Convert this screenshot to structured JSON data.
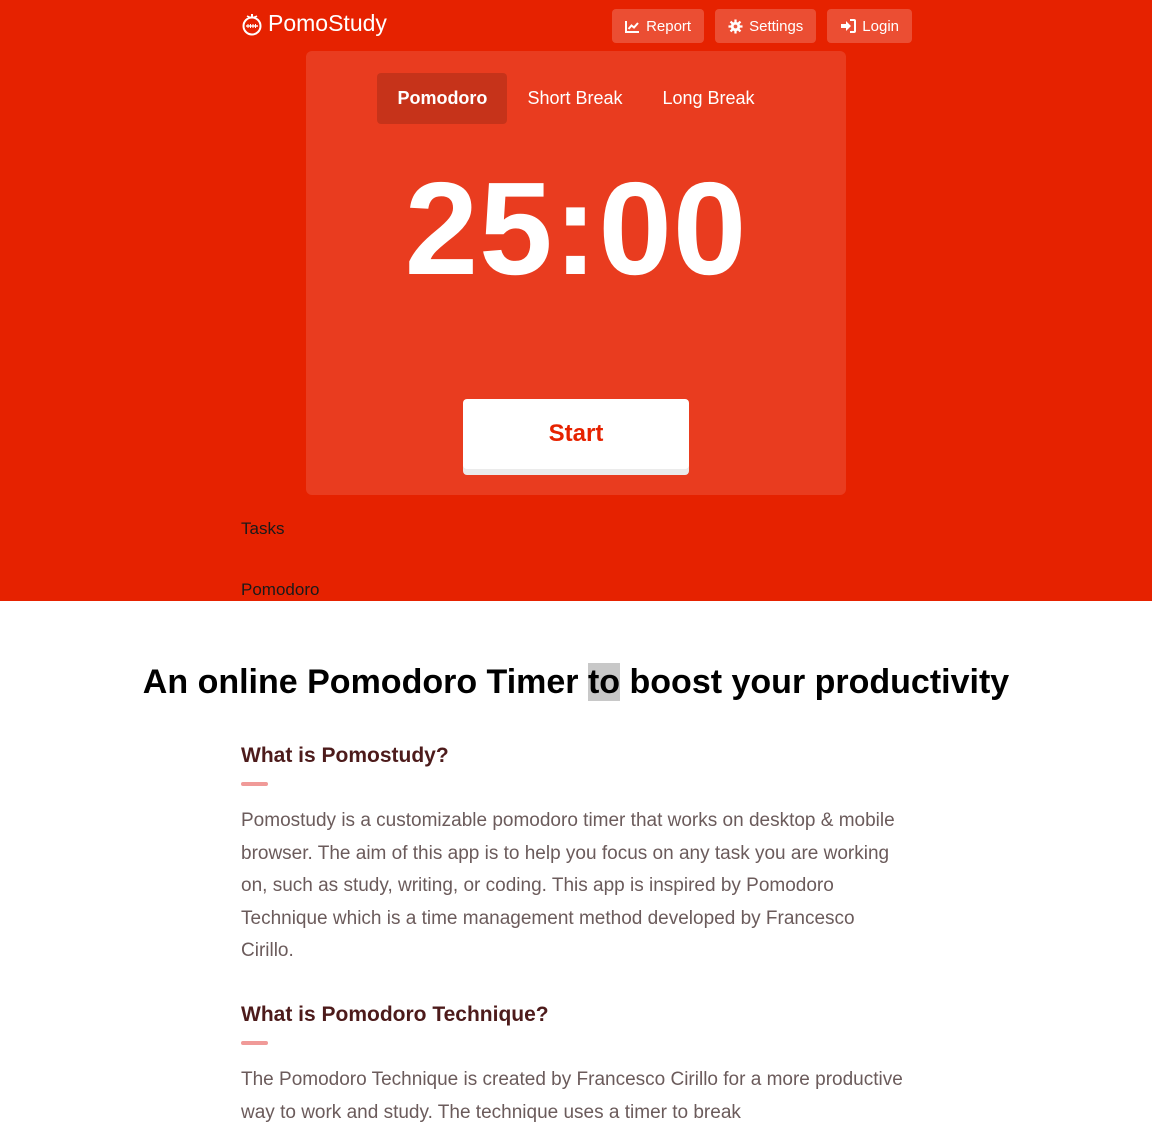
{
  "header": {
    "brand": "PomoStudy",
    "nav": {
      "report": "Report",
      "settings": "Settings",
      "login": "Login"
    }
  },
  "timer_card": {
    "tabs": [
      {
        "label": "Pomodoro",
        "active": true
      },
      {
        "label": "Short Break",
        "active": false
      },
      {
        "label": "Long Break",
        "active": false
      }
    ],
    "time": "25:00",
    "start_label": "Start"
  },
  "tasks_label": "Tasks",
  "current_label": "Pomodoro",
  "article": {
    "title_before": "An online Pomodoro Timer ",
    "title_highlight": "to",
    "title_after": " boost your productivity",
    "sections": [
      {
        "heading": "What is Pomostudy?",
        "body": "Pomostudy is a customizable pomodoro timer that works on desktop & mobile browser. The aim of this app is to help you focus on any task you are working on, such as study, writing, or coding. This app is inspired by Pomodoro Technique which is a time management method developed by Francesco Cirillo."
      },
      {
        "heading": "What is Pomodoro Technique?",
        "body": "The Pomodoro Technique is created by Francesco Cirillo for a more productive way to work and study. The technique uses a timer to break"
      }
    ]
  },
  "colors": {
    "brand_red": "#e62200",
    "heading_dark": "#4d1b1b",
    "accent_bar": "#f09a98",
    "body_text": "#6b5b5b"
  },
  "icons": [
    "pomodoro-logo-icon",
    "chart-icon",
    "gear-icon",
    "sign-in-icon"
  ]
}
